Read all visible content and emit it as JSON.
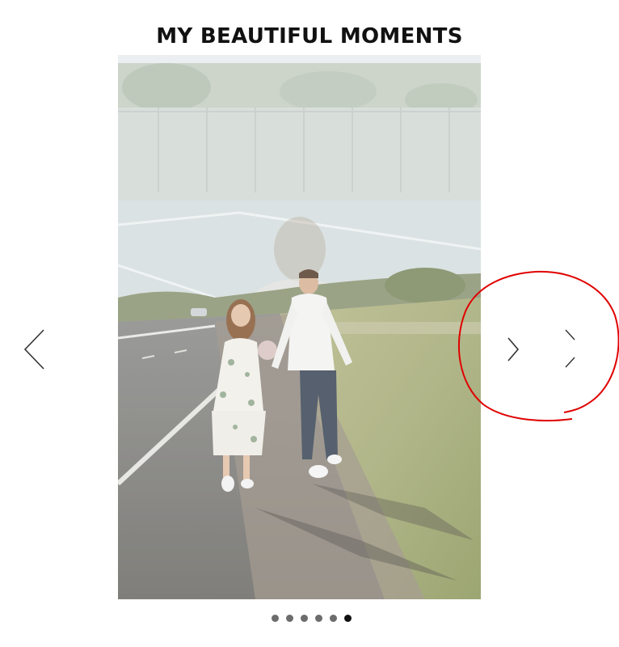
{
  "page": {
    "title": "MY BEAUTIFUL MOMENTS"
  },
  "carousel": {
    "slide_description_icon": "photo-slide",
    "prev_icon": "chevron-left-icon",
    "next_icon": "chevron-right-icon",
    "dot_count": 6,
    "active_dot_index": 5,
    "dot_color": "#6c6c6c",
    "active_dot_color": "#111111"
  },
  "annotation": {
    "color": "#e00000"
  }
}
